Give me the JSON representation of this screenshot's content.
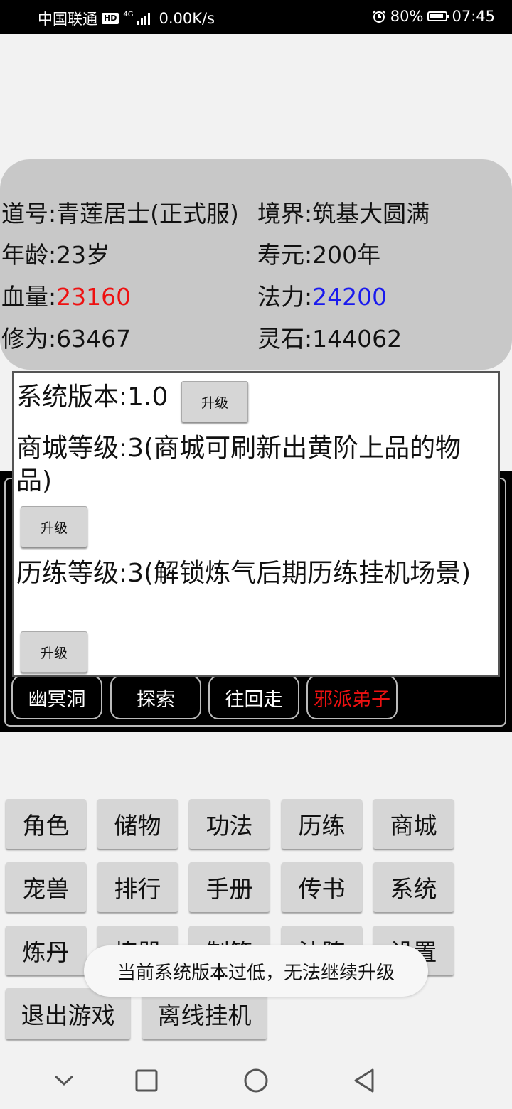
{
  "status_bar": {
    "carrier": "中国联通",
    "hd_badge": "HD",
    "network_type": "4G",
    "speed": "0.00K/s",
    "battery": "80%",
    "time": "07:45",
    "icons": [
      "hd-icon",
      "signal-icon",
      "alarm-icon",
      "battery-icon"
    ]
  },
  "character": {
    "dao_name": "道号:青莲居士(正式服)",
    "realm": "境界:筑基大圆满",
    "age": "年龄:23岁",
    "lifespan": "寿元:200年",
    "hp_label": "血量:",
    "hp_value": "23160",
    "mana_label": "法力:",
    "mana_value": "24200",
    "cultivation": "修为:63467",
    "spirit_stones": "灵石:144062",
    "colors": {
      "hp": "#ee1111",
      "mana": "#1a1aee"
    }
  },
  "system_dialog": {
    "version_text": "系统版本:1.0",
    "shop_level_text": "商城等级:3(商城可刷新出黄阶上品的物品)",
    "train_level_text": "历练等级:3(解锁炼气后期历练挂机场景)",
    "upgrade_label": "升级"
  },
  "scene": {
    "buttons": [
      "幽冥洞",
      "探索",
      "往回走",
      "邪派弟子"
    ],
    "evil_color": "#ee1111"
  },
  "menu": {
    "row1": [
      "角色",
      "储物",
      "功法",
      "历练",
      "商城"
    ],
    "row2": [
      "宠兽",
      "排行",
      "手册",
      "传书",
      "系统"
    ],
    "row3": [
      "炼丹",
      "炼器",
      "制符",
      "法阵",
      "设置"
    ],
    "row4": [
      "退出游戏",
      "离线挂机"
    ]
  },
  "toast": {
    "message": "当前系统版本过低，无法继续升级"
  },
  "nav_bar": {
    "icons": [
      "chevron-down-icon",
      "recent-apps-icon",
      "home-icon",
      "back-icon"
    ]
  }
}
